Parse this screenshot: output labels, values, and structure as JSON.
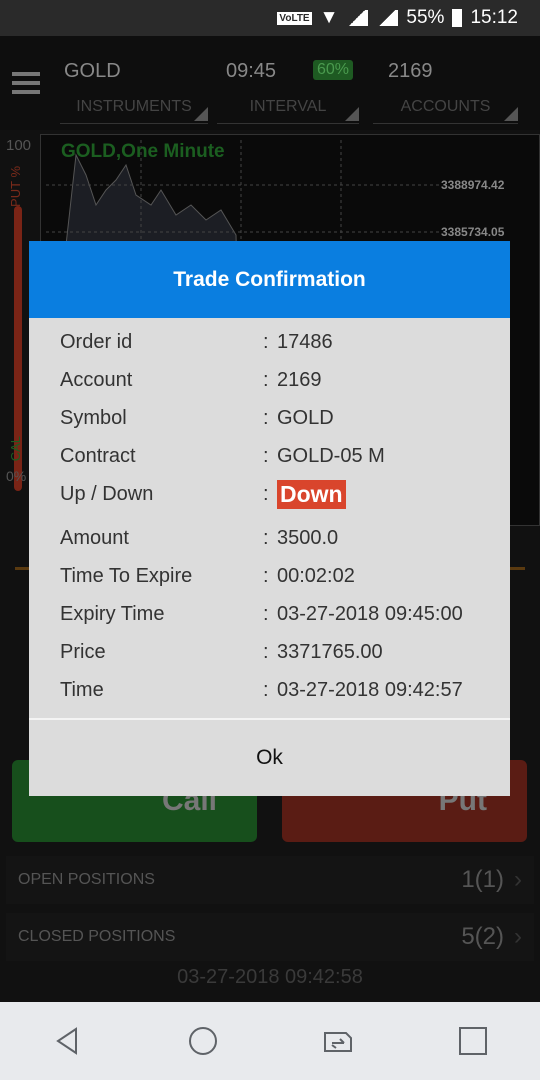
{
  "status_bar": {
    "network": "VoLTE",
    "battery": "55%",
    "time": "15:12"
  },
  "header": {
    "instrument": "GOLD",
    "instrument_label": "INSTRUMENTS",
    "interval": "09:45",
    "payout": "60%",
    "interval_label": "INTERVAL",
    "account": "2169",
    "account_label": "ACCOUNTS"
  },
  "chart": {
    "title": "GOLD,One Minute",
    "y_ticks": [
      "3388974.42",
      "3385734.05"
    ],
    "gauge_top": "100",
    "gauge_put": "PUT %",
    "gauge_call": "CAL",
    "gauge_bottom": "0%"
  },
  "trade": {
    "call": "Call",
    "put": "Put"
  },
  "positions": [
    {
      "label": "OPEN POSITIONS",
      "count": "1(1)"
    },
    {
      "label": "CLOSED POSITIONS",
      "count": "5(2)"
    }
  ],
  "footer_time": "03-27-2018 09:42:58",
  "dialog": {
    "title": "Trade Confirmation",
    "rows": [
      {
        "label": "Order id",
        "value": "17486"
      },
      {
        "label": "Account",
        "value": "2169"
      },
      {
        "label": "Symbol",
        "value": "GOLD"
      },
      {
        "label": "Contract",
        "value": "GOLD-05 M"
      },
      {
        "label": "Up / Down",
        "value": "Down"
      },
      {
        "label": "Amount",
        "value": "3500.0"
      },
      {
        "label": "Time To Expire",
        "value": "00:02:02"
      },
      {
        "label": "Expiry Time",
        "value": "03-27-2018 09:45:00"
      },
      {
        "label": "Price",
        "value": "3371765.00"
      },
      {
        "label": "Time",
        "value": "03-27-2018 09:42:57"
      }
    ],
    "separator": ":",
    "ok": "Ok",
    "down_color": "#d9452c",
    "accent": "#0a7ee0"
  }
}
